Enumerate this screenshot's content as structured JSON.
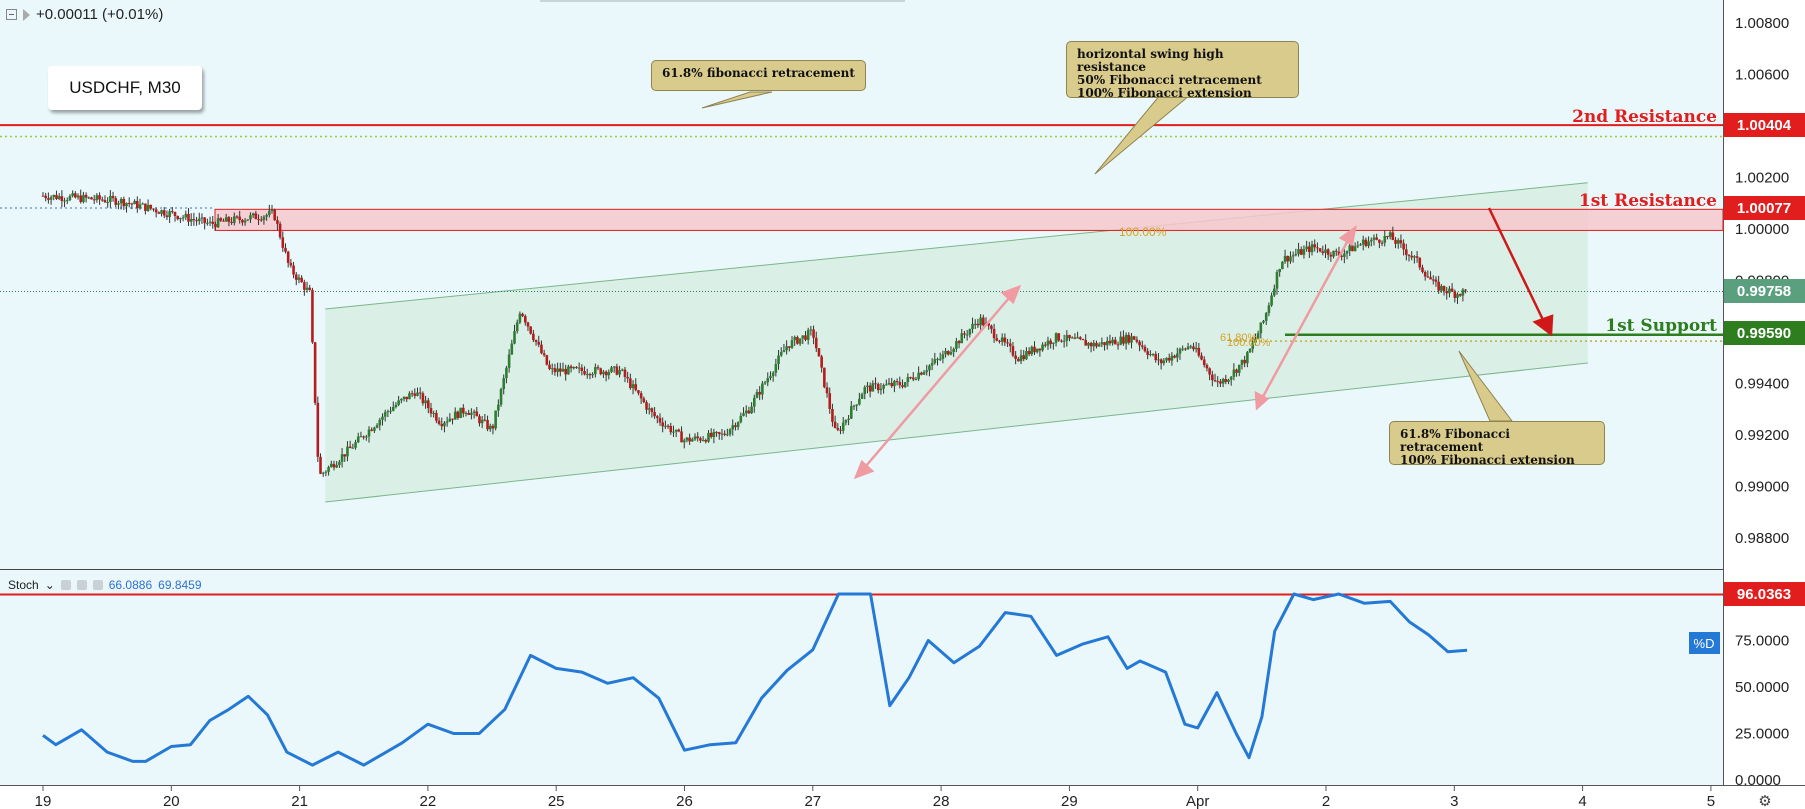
{
  "header": {
    "change": "+0.00011 (+0.01%)"
  },
  "symbol_label": "USDCHF, M30",
  "stoch_header": {
    "name": "Stoch",
    "k_value": "66.0886",
    "d_value": "69.8459"
  },
  "levels": {
    "second_resistance": {
      "label": "2nd Resistance",
      "price": "1.00404",
      "value": 1.00404
    },
    "first_resistance": {
      "label": "1st Resistance",
      "price": "1.00077",
      "value": 1.00077
    },
    "first_support": {
      "label": "1st Support",
      "price": "0.99590",
      "value": 0.9959
    },
    "last_price": {
      "price": "0.99758",
      "value": 0.99758
    },
    "stoch_level": {
      "price": "96.0363",
      "value": 96.0363
    }
  },
  "callouts": {
    "fib_retracement": "61.8% fibonacci retracement",
    "swing_high": [
      "horizontal swing high resistance",
      "50% Fibonacci retracement",
      "100% Fibonacci extension"
    ],
    "support_note": [
      "61.8% Fibonacci retracement",
      "100% Fibonacci extension"
    ]
  },
  "chart_labels": {
    "fib100_upper": "100.00%",
    "fib618_lower": "61.80%",
    "fib100_lower": "100.00%",
    "stoch_d_badge": "%D"
  },
  "colors": {
    "background": "#eaf8fb",
    "resistance": "#e11d1d",
    "support": "#2e7d1f",
    "stoch_line": "#2479d6",
    "channel": "#7ab58b",
    "bull_candle": "#2e7d32",
    "bear_candle": "#b71c1c",
    "callout": "#d9cb8c"
  },
  "chart_data": [
    {
      "type": "candlestick",
      "title": "USDCHF, M30",
      "x_tick_labels": [
        "19",
        "20",
        "21",
        "22",
        "25",
        "26",
        "27",
        "28",
        "29",
        "Apr",
        "2",
        "3",
        "4",
        "5"
      ],
      "y_tick_labels": [
        "1.00800",
        "1.00600",
        "1.00400",
        "1.00200",
        "1.00000",
        "0.99800",
        "0.99600",
        "0.99400",
        "0.99200",
        "0.99000",
        "0.98800"
      ],
      "ylim": [
        0.9868,
        1.0089
      ],
      "close_path": [
        [
          0.0,
          1.0013
        ],
        [
          0.6,
          1.0011
        ],
        [
          1.0,
          1.0006
        ],
        [
          1.3,
          1.0002
        ],
        [
          1.8,
          1.0006
        ],
        [
          1.92,
          0.9985
        ],
        [
          2.08,
          0.9975
        ],
        [
          2.15,
          0.9904
        ],
        [
          2.4,
          0.9915
        ],
        [
          2.7,
          0.993
        ],
        [
          2.9,
          0.9937
        ],
        [
          3.1,
          0.9925
        ],
        [
          3.3,
          0.993
        ],
        [
          3.5,
          0.9922
        ],
        [
          3.72,
          0.9969
        ],
        [
          3.95,
          0.9945
        ],
        [
          4.2,
          0.9945
        ],
        [
          4.5,
          0.9945
        ],
        [
          4.75,
          0.9928
        ],
        [
          5.0,
          0.9918
        ],
        [
          5.3,
          0.992
        ],
        [
          5.5,
          0.993
        ],
        [
          5.8,
          0.9955
        ],
        [
          6.0,
          0.996
        ],
        [
          6.18,
          0.992
        ],
        [
          6.4,
          0.9938
        ],
        [
          6.7,
          0.994
        ],
        [
          7.0,
          0.995
        ],
        [
          7.3,
          0.9965
        ],
        [
          7.6,
          0.995
        ],
        [
          7.9,
          0.9958
        ],
        [
          8.2,
          0.9955
        ],
        [
          8.5,
          0.9958
        ],
        [
          8.7,
          0.9948
        ],
        [
          8.95,
          0.9955
        ],
        [
          9.15,
          0.994
        ],
        [
          9.25,
          0.9943
        ],
        [
          9.38,
          0.995
        ],
        [
          9.52,
          0.9965
        ],
        [
          9.65,
          0.9988
        ],
        [
          9.9,
          0.9993
        ],
        [
          10.1,
          0.999
        ],
        [
          10.3,
          0.9995
        ],
        [
          10.5,
          0.9997
        ],
        [
          10.7,
          0.9988
        ],
        [
          10.85,
          0.9978
        ],
        [
          11.0,
          0.9975
        ],
        [
          11.1,
          0.99758
        ]
      ],
      "channel": {
        "upper": [
          [
            2.2,
            0.9969
          ],
          [
            12.04,
            1.0018
          ]
        ],
        "lower": [
          [
            2.2,
            0.9894
          ],
          [
            12.04,
            0.9948
          ]
        ]
      },
      "resistance_zone": [
        0.99995,
        1.00077
      ]
    },
    {
      "type": "line",
      "name": "Stoch",
      "y_tick_labels": [
        "75.0000",
        "50.0000",
        "25.0000",
        "0.0000"
      ],
      "ylim": [
        0,
        100
      ],
      "series": [
        {
          "name": "%D",
          "values": [
            [
              0.0,
              24
            ],
            [
              0.1,
              19
            ],
            [
              0.3,
              27
            ],
            [
              0.5,
              15
            ],
            [
              0.7,
              10
            ],
            [
              0.8,
              10
            ],
            [
              1.0,
              18
            ],
            [
              1.15,
              19
            ],
            [
              1.3,
              32
            ],
            [
              1.45,
              38
            ],
            [
              1.6,
              45
            ],
            [
              1.75,
              35
            ],
            [
              1.9,
              15
            ],
            [
              2.1,
              8
            ],
            [
              2.3,
              15
            ],
            [
              2.5,
              8
            ],
            [
              2.8,
              20
            ],
            [
              3.0,
              30
            ],
            [
              3.2,
              25
            ],
            [
              3.4,
              25
            ],
            [
              3.6,
              38
            ],
            [
              3.8,
              67
            ],
            [
              4.0,
              60
            ],
            [
              4.2,
              58
            ],
            [
              4.4,
              52
            ],
            [
              4.6,
              55
            ],
            [
              4.8,
              44
            ],
            [
              5.0,
              16
            ],
            [
              5.2,
              19
            ],
            [
              5.4,
              20
            ],
            [
              5.6,
              44
            ],
            [
              5.8,
              59
            ],
            [
              6.0,
              70
            ],
            [
              6.2,
              100
            ],
            [
              6.45,
              100
            ],
            [
              6.6,
              40
            ],
            [
              6.75,
              55
            ],
            [
              6.9,
              75
            ],
            [
              7.1,
              63
            ],
            [
              7.3,
              72
            ],
            [
              7.5,
              90
            ],
            [
              7.7,
              88
            ],
            [
              7.9,
              67
            ],
            [
              8.1,
              73
            ],
            [
              8.3,
              77
            ],
            [
              8.45,
              60
            ],
            [
              8.55,
              64
            ],
            [
              8.75,
              58
            ],
            [
              8.9,
              30
            ],
            [
              9.0,
              28
            ],
            [
              9.15,
              47
            ],
            [
              9.3,
              25
            ],
            [
              9.4,
              12
            ],
            [
              9.5,
              34
            ],
            [
              9.6,
              80
            ],
            [
              9.75,
              100
            ],
            [
              9.9,
              97
            ],
            [
              10.1,
              100
            ],
            [
              10.3,
              95
            ],
            [
              10.5,
              96
            ],
            [
              10.65,
              85
            ],
            [
              10.8,
              78
            ],
            [
              10.95,
              69
            ],
            [
              11.1,
              69.8
            ]
          ]
        },
        {
          "name": "%K",
          "values": [
            [
              11.1,
              66.0886
            ]
          ]
        }
      ]
    }
  ]
}
